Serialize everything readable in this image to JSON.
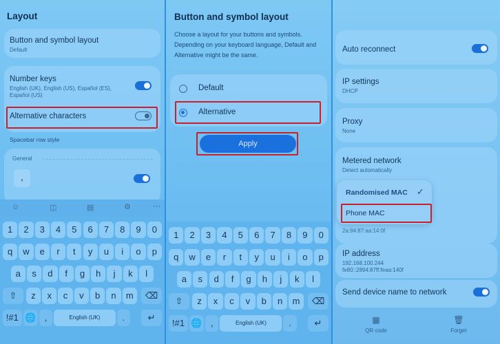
{
  "panel1": {
    "title": "Layout",
    "button_layout_label": "Button and symbol layout",
    "button_layout_value": "Default",
    "number_keys_label": "Number keys",
    "number_keys_sub_1": "English (UK), English (US), Español (ES),",
    "number_keys_sub_2": "Español (US)",
    "alt_chars_label": "Alternative characters",
    "spacebar_label": "Spacebar row style",
    "general_label": "General",
    "comma": ","
  },
  "panel2": {
    "title": "Button and symbol layout",
    "description_1": "Choose a layout for your buttons and symbols.",
    "description_2": "Depending on your keyboard language, Default and",
    "description_3": "Alternative might be the same.",
    "option_default": "Default",
    "option_alternative": "Alternative",
    "apply_label": "Apply"
  },
  "keyboard": {
    "numbers": [
      "1",
      "2",
      "3",
      "4",
      "5",
      "6",
      "7",
      "8",
      "9",
      "0"
    ],
    "row1": [
      "q",
      "w",
      "e",
      "r",
      "t",
      "y",
      "u",
      "i",
      "o",
      "p"
    ],
    "row2": [
      "a",
      "s",
      "d",
      "f",
      "g",
      "h",
      "j",
      "k",
      "l"
    ],
    "row3": [
      "z",
      "x",
      "c",
      "v",
      "b",
      "n",
      "m"
    ],
    "symbols_label": "!#1",
    "space_label": "English (UK)"
  },
  "panel3": {
    "auto_reconnect": "Auto reconnect",
    "ip_settings": "IP settings",
    "ip_settings_value": "DHCP",
    "proxy": "Proxy",
    "proxy_value": "None",
    "metered": "Metered network",
    "metered_value": "Detect automatically",
    "randomised_mac": "Randomised MAC",
    "phone_mac": "Phone MAC",
    "mac_partial": "2a:94:87:aa:14:0f",
    "ip_address": "IP address",
    "ip_v4": "192.168.100.244",
    "ip_v6": "fe80::2894:87ff:feaa:140f",
    "send_name": "Send device name to network",
    "qr_code": "QR code",
    "forget": "Forget"
  },
  "colors": {
    "accent": "#1a6fd8",
    "highlight": "#c8202a",
    "background": "#6cbdf1"
  },
  "icons": [
    "emoji-icon",
    "sticker-icon",
    "clipboard-icon",
    "settings-icon",
    "more-icon",
    "shift-icon",
    "backspace-icon",
    "globe-icon",
    "enter-icon",
    "checkmark-icon",
    "qr-code-icon",
    "trash-icon"
  ]
}
